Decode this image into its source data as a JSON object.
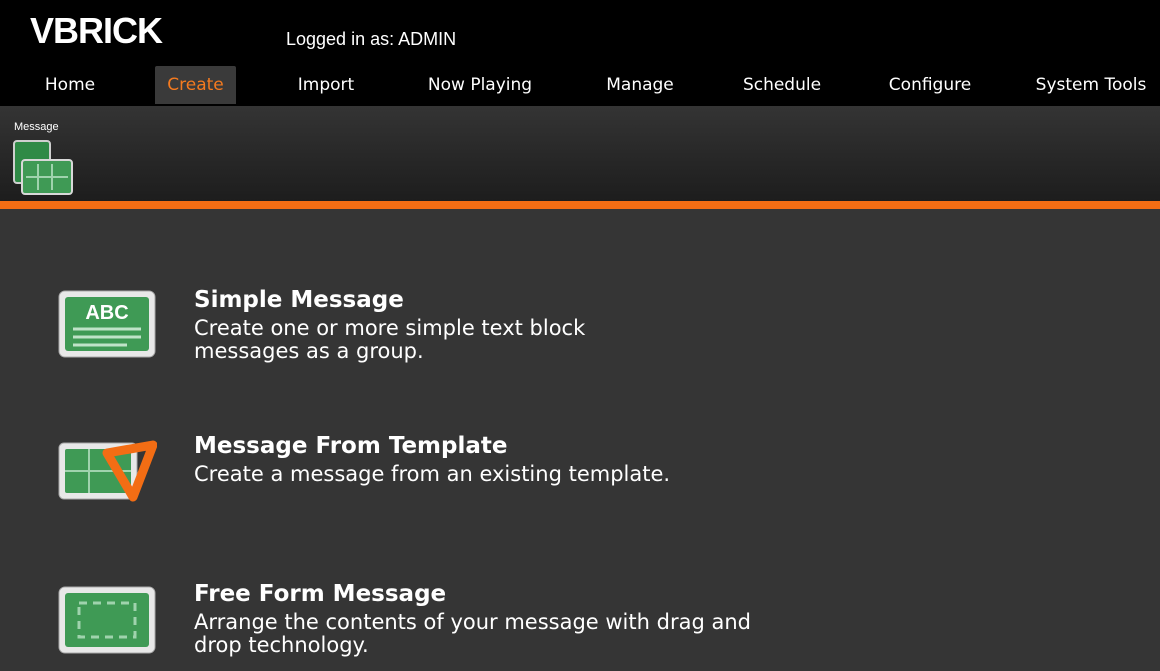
{
  "brand": {
    "logo_text": "VBRICK"
  },
  "header": {
    "logged_in": "Logged in as: ADMIN"
  },
  "nav": {
    "items": [
      {
        "label": "Home",
        "active": false
      },
      {
        "label": "Create",
        "active": true
      },
      {
        "label": "Import",
        "active": false
      },
      {
        "label": "Now Playing",
        "active": false
      },
      {
        "label": "Manage",
        "active": false
      },
      {
        "label": "Schedule",
        "active": false
      },
      {
        "label": "Configure",
        "active": false
      },
      {
        "label": "System Tools",
        "active": false
      }
    ]
  },
  "subnav": {
    "label": "Message"
  },
  "options": [
    {
      "title": "Simple Message",
      "description": "Create one or more simple text block messages as a group.",
      "icon": "abc-text-icon",
      "icon_text": "ABC"
    },
    {
      "title": "Message From Template",
      "description": "Create a message from an existing template.",
      "icon": "template-ruler-icon"
    },
    {
      "title": "Free Form Message",
      "description": "Arrange the contents of your message with drag and drop technology.",
      "icon": "free-form-icon"
    }
  ],
  "colors": {
    "accent": "#f36d14",
    "active_nav_text": "#f47a1f",
    "background": "#353535",
    "topbar": "#000000",
    "icon_green": "#3f9a55"
  }
}
